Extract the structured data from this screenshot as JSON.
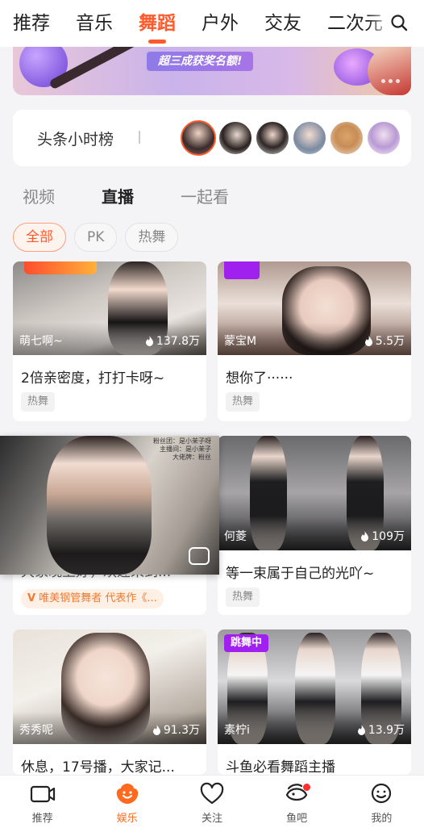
{
  "top_tabs": [
    {
      "label": "推荐"
    },
    {
      "label": "音乐"
    },
    {
      "label": "舞蹈"
    },
    {
      "label": "户外"
    },
    {
      "label": "交友"
    },
    {
      "label": "二次元"
    }
  ],
  "active_top_tab": "舞蹈",
  "banner": {
    "text": "超三成获奖名额!"
  },
  "rank": {
    "title": "头条小时榜"
  },
  "sub_tabs": [
    {
      "label": "视频"
    },
    {
      "label": "直播"
    },
    {
      "label": "一起看"
    }
  ],
  "active_sub_tab": "直播",
  "chips": [
    {
      "label": "全部"
    },
    {
      "label": "PK"
    },
    {
      "label": "热舞"
    }
  ],
  "active_chip": "全部",
  "cards": [
    {
      "anchor": "萌七啊~",
      "views": "137.8万",
      "title": "2倍亲密度，打打卡呀~",
      "tag": "热舞"
    },
    {
      "anchor": "蒙宝M",
      "views": "5.5万",
      "title": "想你了······",
      "tag": "热舞"
    },
    {
      "title": "大家晚上好，欢迎来到...",
      "feature": "唯美钢管舞者 代表作《..."
    },
    {
      "anchor": "何菱",
      "views": "109万",
      "title": "等一束属于自己的光吖~",
      "tag": "热舞"
    },
    {
      "anchor": "秀秀呢",
      "views": "91.3万",
      "title": "休息，17号播，大家记..."
    },
    {
      "badge": "跳舞中",
      "anchor": "素柠i",
      "views": "13.9万",
      "title": "斗鱼必看舞蹈主播"
    }
  ],
  "float_video": {
    "info": [
      "粉丝团：是小茉子呀",
      "主播间：是小茉子",
      "大佬牌：粉丝"
    ]
  },
  "bottom_nav": [
    {
      "label": "推荐",
      "icon": "video-camera-icon"
    },
    {
      "label": "娱乐",
      "icon": "entertainment-icon"
    },
    {
      "label": "关注",
      "icon": "heart-icon"
    },
    {
      "label": "鱼吧",
      "icon": "fish-bar-icon"
    },
    {
      "label": "我的",
      "icon": "profile-icon"
    }
  ],
  "colors": {
    "accent": "#ff5a2c",
    "badge_purple": "#a020f0",
    "nav_active": "#ff6a1f"
  }
}
